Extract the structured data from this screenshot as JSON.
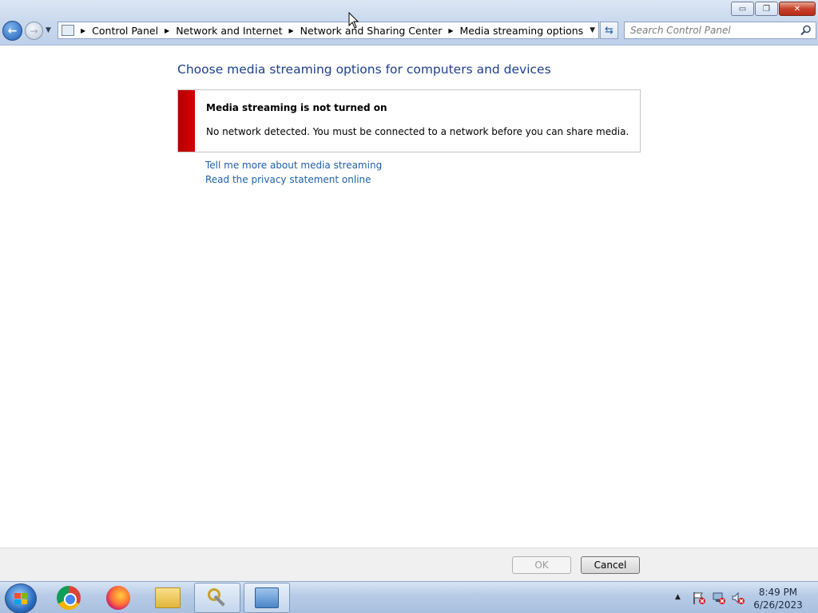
{
  "window": {
    "buttons": {
      "minimize": "▭",
      "restore": "❐",
      "close": "✕"
    }
  },
  "addressbar": {
    "breadcrumbs": [
      "Control Panel",
      "Network and Internet",
      "Network and Sharing Center",
      "Media streaming options"
    ]
  },
  "search": {
    "placeholder": "Search Control Panel"
  },
  "main": {
    "heading": "Choose media streaming options for computers and devices",
    "alert": {
      "title": "Media streaming is not turned on",
      "message": "No network detected.  You must be connected to a network before you can share media.",
      "bar_color": "#c80000"
    },
    "links": [
      "Tell me more about media streaming",
      "Read the privacy statement online"
    ]
  },
  "footer": {
    "ok_label": "OK",
    "cancel_label": "Cancel",
    "ok_enabled": false
  },
  "taskbar": {
    "items": [
      "start-orb",
      "chrome-icon",
      "firefox-icon",
      "file-explorer-icon",
      "credential-manager-icon",
      "control-panel-icon"
    ],
    "tray": {
      "icons": [
        "action-center-flag-icon",
        "network-disconnected-icon",
        "volume-muted-icon"
      ]
    },
    "clock": {
      "time": "8:49 PM",
      "date": "6/26/2023"
    }
  },
  "colors": {
    "link": "#1f5fa9",
    "heading": "#1e3f8c",
    "alert_bar": "#c80000"
  }
}
